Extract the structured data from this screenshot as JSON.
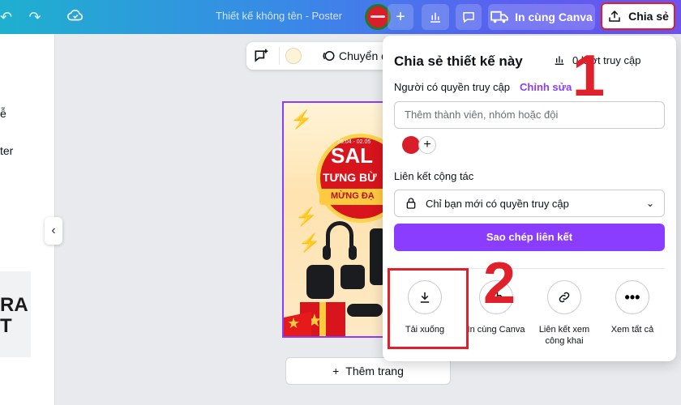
{
  "app": {
    "doc_title": "Thiết kế không tên - Poster",
    "print_label": "In cùng Canva",
    "share_label": "Chia sẻ"
  },
  "left_panel": {
    "texts": [
      "ễ",
      "ter"
    ],
    "thumb_text": [
      "RA",
      "T"
    ]
  },
  "float_tools": {
    "label": "Chuyển đ"
  },
  "poster": {
    "sale": "SAL",
    "sub": "TƯNG BỪ",
    "mung": "MỪNG ĐẠ",
    "date": "26.04 - 02.05"
  },
  "add_page": {
    "label": "Thêm trang"
  },
  "share_panel": {
    "title": "Chia sẻ thiết kế này",
    "stats": "0 lượt truy cập",
    "access_label": "Người có quyền truy cập",
    "access_edit": "Chỉnh sửa",
    "input_placeholder": "Thêm thành viên, nhóm hoặc đội",
    "link_label": "Liên kết cộng tác",
    "link_select": "Chỉ bạn mới có quyền truy cập",
    "copy_button": "Sao chép liên kết",
    "options": [
      {
        "label": "Tải xuống",
        "icon": "download-icon"
      },
      {
        "label": "In cùng Canva",
        "icon": "print-icon"
      },
      {
        "label": "Liên kết xem công khai",
        "icon": "link-icon"
      },
      {
        "label": "Xem tất cả",
        "icon": "more-icon"
      }
    ]
  },
  "annotations": {
    "step1": "1",
    "step2": "2"
  }
}
